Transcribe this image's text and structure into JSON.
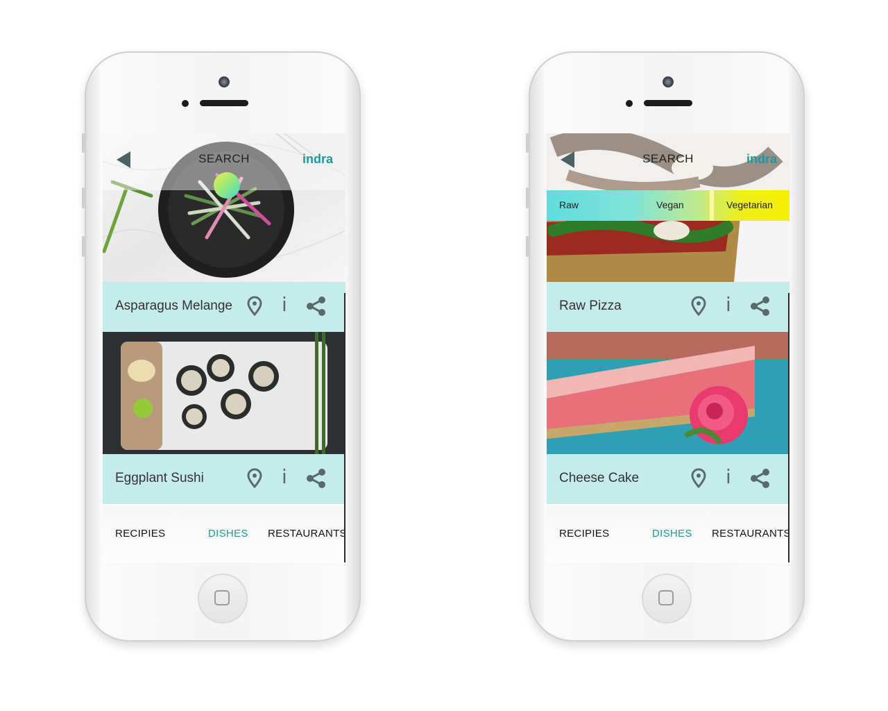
{
  "colors": {
    "accent": "#1c9aa0",
    "item_bar": "#c6ebeb",
    "icon": "#5a6a6a"
  },
  "screens": [
    {
      "header": {
        "back_icon": "back-arrow-icon",
        "title": "SEARCH",
        "brand": "indra"
      },
      "items": [
        {
          "name": "Asparagus Melange",
          "photo": "asparagus-melange-photo"
        },
        {
          "name": "Eggplant Sushi",
          "photo": "eggplant-sushi-photo"
        }
      ],
      "tabs": [
        {
          "label": "RECIPIES",
          "active": false
        },
        {
          "label": "DISHES",
          "active": true
        },
        {
          "label": "RESTAURANTS",
          "active": false
        }
      ]
    },
    {
      "header": {
        "back_icon": "back-arrow-icon",
        "title": "SEARCH",
        "brand": "indra"
      },
      "filters": [
        "Raw",
        "Vegan",
        "Vegetarian"
      ],
      "items": [
        {
          "name": "Raw Pizza",
          "photo": "raw-pizza-photo"
        },
        {
          "name": "Cheese Cake",
          "photo": "cheese-cake-photo"
        }
      ],
      "tabs": [
        {
          "label": "RECIPIES",
          "active": false
        },
        {
          "label": "DISHES",
          "active": true
        },
        {
          "label": "RESTAURANTS",
          "active": false
        }
      ]
    }
  ]
}
